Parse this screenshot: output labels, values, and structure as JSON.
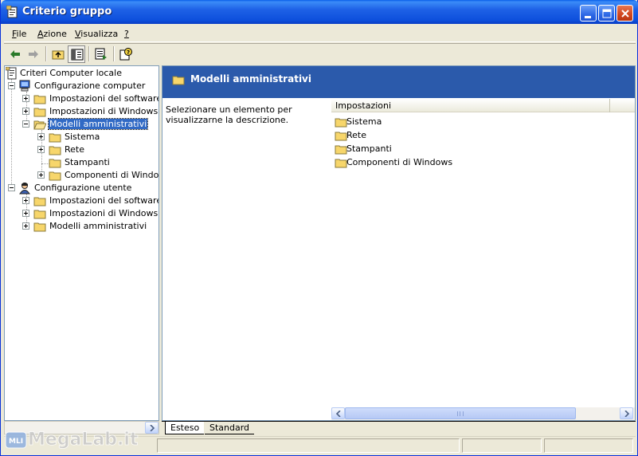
{
  "window": {
    "title": "Criterio gruppo"
  },
  "menu": [
    {
      "label": "File",
      "underline": "F",
      "rest": "ile"
    },
    {
      "label": "Azione",
      "underline": "A",
      "rest": "zione"
    },
    {
      "label": "Visualizza",
      "underline": "V",
      "rest": "isualizza"
    },
    {
      "label": "?",
      "underline": "?",
      "rest": ""
    }
  ],
  "toolbar": {
    "buttons": [
      "back-icon",
      "forward-icon",
      "up-folder-icon",
      "show-hide-tree-icon",
      "export-list-icon",
      "help-icon"
    ]
  },
  "tree": {
    "root": "Criteri Computer locale",
    "computer_config": "Configurazione computer",
    "cc_software": "Impostazioni del software",
    "cc_windows": "Impostazioni di Windows",
    "cc_admin": "Modelli amministrativi",
    "cc_admin_system": "Sistema",
    "cc_admin_network": "Rete",
    "cc_admin_printers": "Stampanti",
    "cc_admin_components": "Componenti di Windows",
    "user_config": "Configurazione utente",
    "uc_software": "Impostazioni del software",
    "uc_windows": "Impostazioni di Windows",
    "uc_admin": "Modelli amministrativi"
  },
  "details": {
    "header_title": "Modelli amministrativi",
    "description": "Selezionare un elemento per visualizzarne la descrizione.",
    "column_header": "Impostazioni",
    "items": [
      "Sistema",
      "Rete",
      "Stampanti",
      "Componenti di Windows"
    ]
  },
  "tabs": {
    "extended": "Esteso",
    "standard": "Standard"
  },
  "watermark": {
    "text": "MegaLab.it"
  },
  "colors": {
    "titlebar": "#0d4fdc",
    "details_header": "#2b5aab",
    "selection": "#316ac5",
    "folder": "#f7d66b"
  }
}
